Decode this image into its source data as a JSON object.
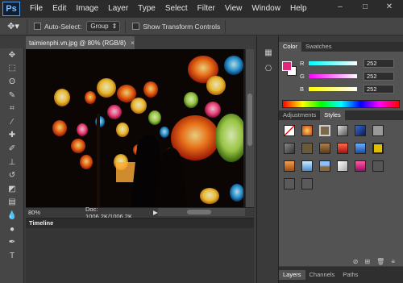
{
  "menubar": {
    "logo": "Ps",
    "items": [
      "File",
      "Edit",
      "Image",
      "Layer",
      "Type",
      "Select",
      "Filter",
      "View",
      "Window",
      "Help"
    ],
    "win_min": "–",
    "win_max": "□",
    "win_close": "✕"
  },
  "options": {
    "tool_preset_icon": "move-tool-icon",
    "auto_select_label": "Auto-Select:",
    "auto_select_value": "Group",
    "show_transform_label": "Show Transform Controls"
  },
  "document": {
    "tab_title": "taimienphi.vn.jpg @ 80% (RGB/8)",
    "zoom": "80%",
    "doc_size": "Doc: 1006.2K/1006.2K"
  },
  "timeline": {
    "tab_label": "Timeline"
  },
  "color_panel": {
    "tabs": [
      "Color",
      "Swatches"
    ],
    "fg_color": "#e0287a",
    "bg_color": "#ffffff",
    "channels": [
      {
        "name": "R",
        "value": "252"
      },
      {
        "name": "G",
        "value": "252"
      },
      {
        "name": "B",
        "value": "252"
      }
    ]
  },
  "styles_panel": {
    "tabs": [
      "Adjustments",
      "Styles"
    ]
  },
  "layers_panel": {
    "tabs": [
      "Layers",
      "Channels",
      "Paths"
    ]
  }
}
